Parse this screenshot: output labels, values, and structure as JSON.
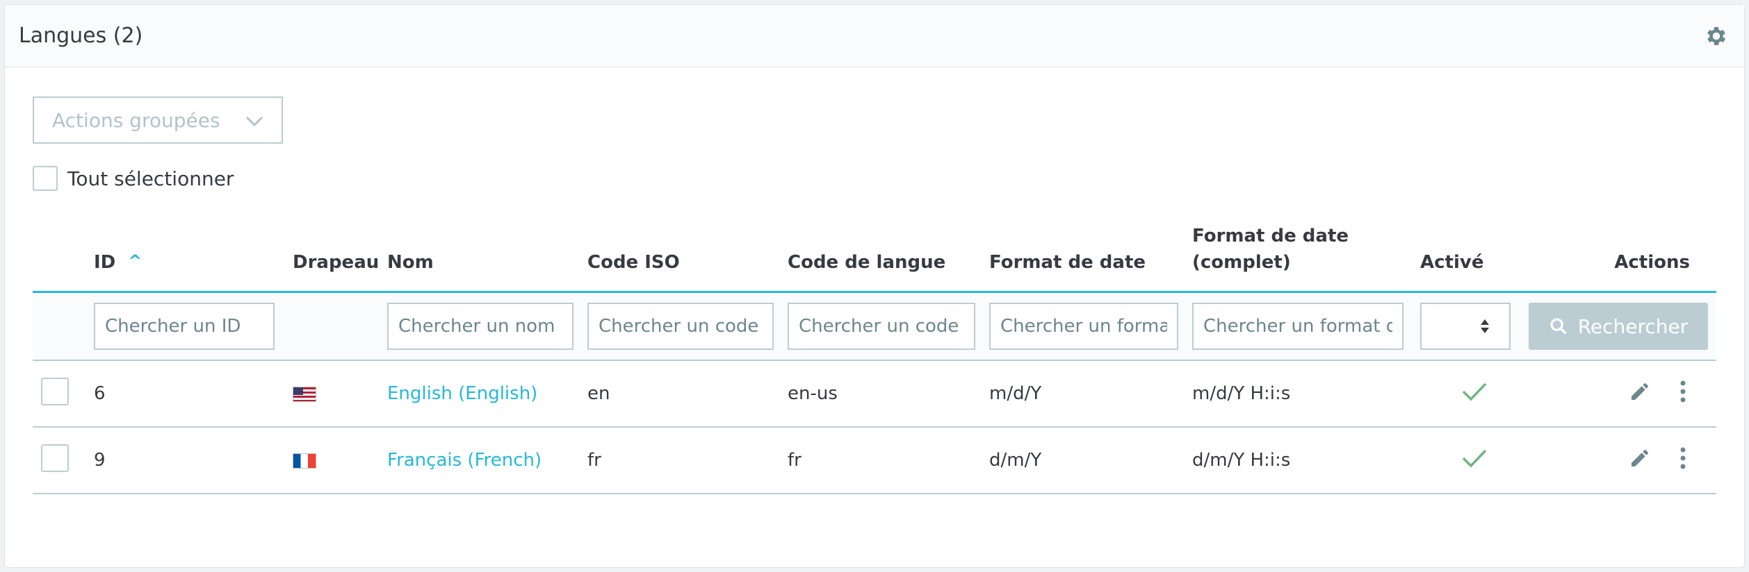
{
  "header": {
    "title": "Langues (2)"
  },
  "bulk": {
    "label": "Actions groupées"
  },
  "select_all": {
    "label": "Tout sélectionner"
  },
  "columns": {
    "id": "ID",
    "flag": "Drapeau",
    "name": "Nom",
    "iso": "Code ISO",
    "lang_code": "Code de langue",
    "date_format": "Format de date",
    "date_full_line1": "Format de date",
    "date_full_line2": "(complet)",
    "active": "Activé",
    "actions": "Actions"
  },
  "filters": {
    "id": "Chercher un ID",
    "name": "Chercher un nom",
    "iso": "Chercher un code",
    "lang_code": "Chercher un code",
    "date_format": "Chercher un format",
    "date_full": "Chercher un format de date",
    "search_button": "Rechercher"
  },
  "rows": [
    {
      "id": "6",
      "flag": "us",
      "name": "English (English)",
      "iso": "en",
      "lang_code": "en-us",
      "date_format": "m/d/Y",
      "date_full": "m/d/Y H:i:s",
      "active": true
    },
    {
      "id": "9",
      "flag": "fr",
      "name": "Français (French)",
      "iso": "fr",
      "lang_code": "fr",
      "date_format": "d/m/Y",
      "date_full": "d/m/Y H:i:s",
      "active": true
    }
  ],
  "colors": {
    "accent": "#25b9d7",
    "success": "#70b580",
    "border": "#bbcdd2",
    "button_disabled": "#bbcdd2"
  }
}
